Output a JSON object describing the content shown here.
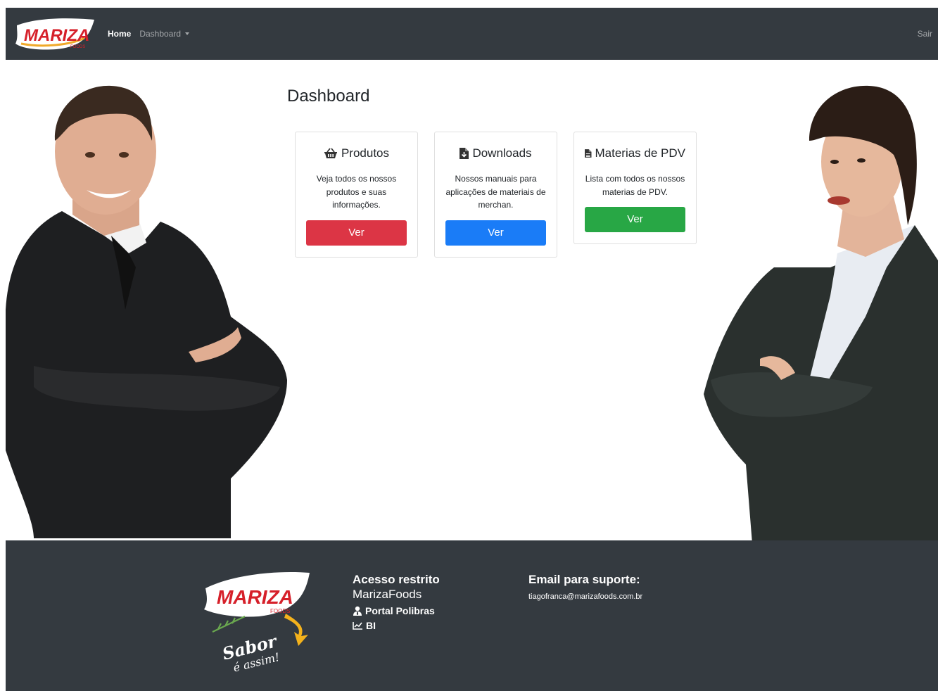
{
  "brand": {
    "logo_text": "MARIZA",
    "logo_sub": "FOODS",
    "slogan_line1": "Sabor",
    "slogan_line2": "é assim!"
  },
  "nav": {
    "home": "Home",
    "dashboard": "Dashboard",
    "logout": "Sair"
  },
  "page_title": "Dashboard",
  "cards": [
    {
      "title": "Produtos",
      "text": "Veja todos os nossos produtos e suas informações.",
      "button": "Ver",
      "icon": "basket-icon",
      "color": "#dc3545"
    },
    {
      "title": "Downloads",
      "text": "Nossos manuais para aplicações de materiais de merchan.",
      "button": "Ver",
      "icon": "file-download-icon",
      "color": "#1a7cf7"
    },
    {
      "title": "Materias de PDV",
      "text": "Lista com todos os nossos materias de PDV.",
      "button": "Ver",
      "icon": "document-icon",
      "color": "#28a745"
    }
  ],
  "footer": {
    "restricted_line1": "Acesso restrito",
    "restricted_line2": "MarizaFoods",
    "portal_link": "Portal Polibras",
    "bi_link": "BI",
    "support_title": "Email para suporte:",
    "support_email": "tiagofranca@marizafoods.com.br"
  }
}
